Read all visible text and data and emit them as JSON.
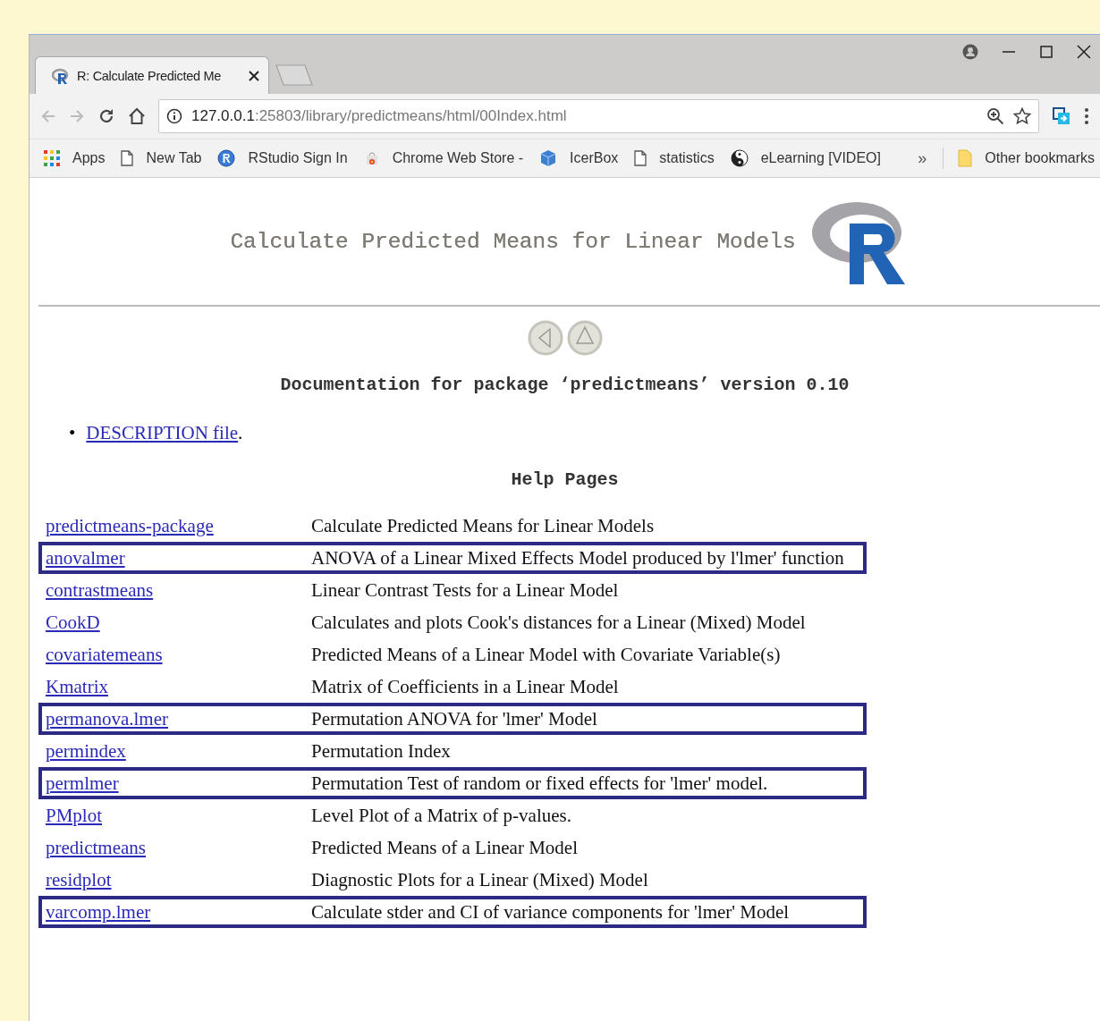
{
  "window": {
    "tab_title": "R: Calculate Predicted Me",
    "address": {
      "host": "127.0.0.1",
      "path": ":25803/library/predictmeans/html/00Index.html"
    }
  },
  "bookmarks": [
    {
      "label": "Apps",
      "kind": "apps"
    },
    {
      "label": "New Tab",
      "kind": "page"
    },
    {
      "label": "RStudio Sign In",
      "kind": "rstudio"
    },
    {
      "label": "Chrome Web Store -",
      "kind": "store"
    },
    {
      "label": "IcerBox",
      "kind": "cube"
    },
    {
      "label": "statistics",
      "kind": "page"
    },
    {
      "label": "eLearning [VIDEO]",
      "kind": "yinyang"
    }
  ],
  "bookmarks_overflow": "»",
  "other_bookmarks": "Other bookmarks",
  "page": {
    "title": "Calculate Predicted Means for Linear Models",
    "doc_heading": "Documentation for package ‘predictmeans’ version 0.10",
    "description_link": {
      "bullet": "•",
      "text": "DESCRIPTION file",
      "after": "."
    },
    "help_heading": "Help Pages",
    "rows": [
      {
        "name": "predictmeans-package",
        "description": "Calculate Predicted Means for Linear Models",
        "highlighted": false
      },
      {
        "name": "anovalmer",
        "description": "ANOVA of a Linear Mixed Effects Model produced by l'lmer' function",
        "highlighted": true
      },
      {
        "name": "contrastmeans",
        "description": "Linear Contrast Tests for a Linear Model",
        "highlighted": false
      },
      {
        "name": "CookD",
        "description": "Calculates and plots Cook's distances for a Linear (Mixed) Model",
        "highlighted": false
      },
      {
        "name": "covariatemeans",
        "description": "Predicted Means of a Linear Model with Covariate Variable(s)",
        "highlighted": false
      },
      {
        "name": "Kmatrix",
        "description": "Matrix of Coefficients in a Linear Model",
        "highlighted": false
      },
      {
        "name": "permanova.lmer",
        "description": "Permutation ANOVA for 'lmer' Model",
        "highlighted": true
      },
      {
        "name": "permindex",
        "description": "Permutation Index",
        "highlighted": false
      },
      {
        "name": "permlmer",
        "description": "Permutation Test of random or fixed effects for 'lmer' model.",
        "highlighted": true
      },
      {
        "name": "PMplot",
        "description": "Level Plot of a Matrix of p-values.",
        "highlighted": false
      },
      {
        "name": "predictmeans",
        "description": "Predicted Means of a Linear Model",
        "highlighted": false
      },
      {
        "name": "residplot",
        "description": "Diagnostic Plots for a Linear (Mixed) Model",
        "highlighted": false
      },
      {
        "name": "varcomp.lmer",
        "description": "Calculate stder and CI of variance components for 'lmer' Model",
        "highlighted": true
      }
    ]
  }
}
